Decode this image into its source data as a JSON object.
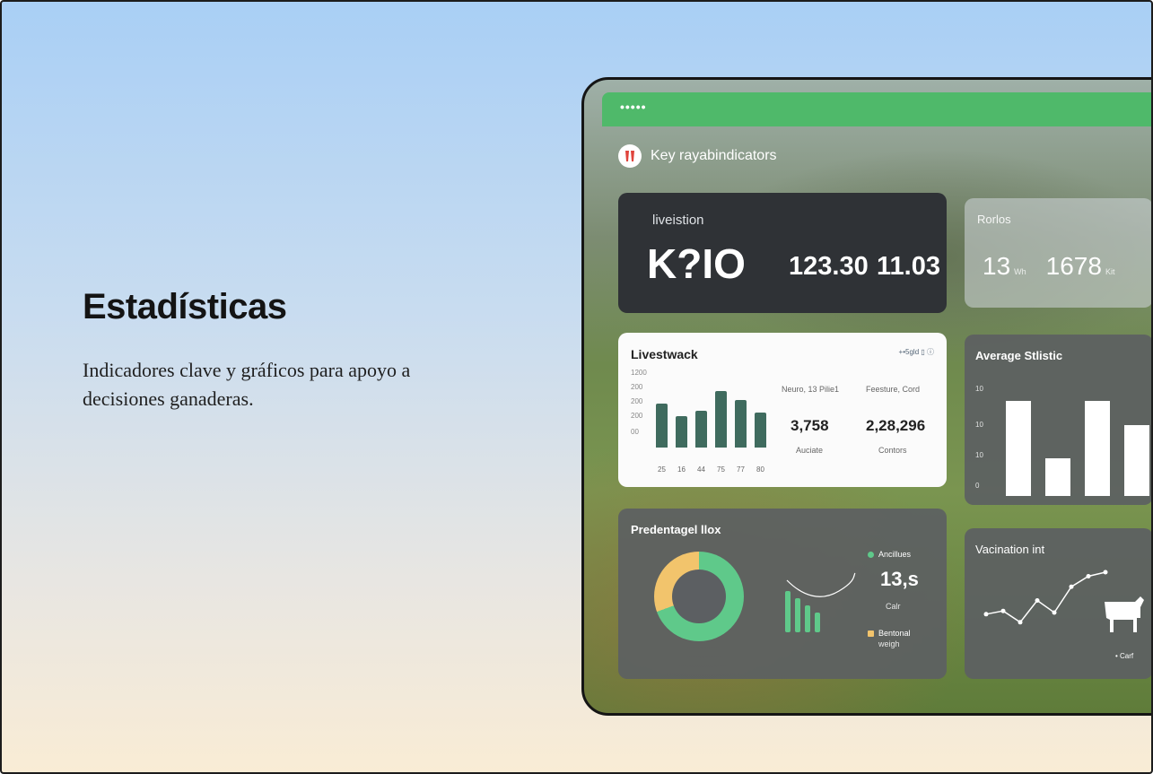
{
  "hero": {
    "title": "Estadísticas",
    "subtitle": "Indicadores clave y gráficos para apoyo a decisiones ganaderas."
  },
  "dashboard": {
    "window_dots": "•••••",
    "brand_title": "Key rayabindicators",
    "kpi_card": {
      "label": "liveistion",
      "main_value": "K?IO",
      "value_1": "123.30",
      "value_2": "11.03"
    },
    "ratio_card": {
      "label": "Rorlos",
      "value_1": "13",
      "unit_1": "Wh",
      "value_2": "1678",
      "unit_2": "Kit"
    },
    "livestock_card": {
      "title": "Livestwack",
      "legend": "+•5gld  ▯  ⓘ",
      "stat_1_label": "Neuro, 13 Pilie1",
      "stat_1_value": "3,758",
      "stat_1_caption": "Auciate",
      "stat_2_label": "Feesture, Cord",
      "stat_2_value": "2,28,296",
      "stat_2_caption": "Contors"
    },
    "average_card": {
      "title": "Average Stlistic",
      "y_ticks": [
        "10",
        "10",
        "10",
        "0"
      ]
    },
    "percentage_card": {
      "title": "Predentagel llox",
      "legend_1": "Ancillues",
      "big_value": "13,s",
      "caption": "Calr",
      "legend_2": "Bentonal",
      "legend_2b": "weigh"
    },
    "vaccination_card": {
      "title": "Vacination int",
      "legend": "• Carf"
    }
  },
  "chart_data": [
    {
      "type": "bar",
      "title": "Livestwack",
      "categories": [
        "25",
        "16",
        "44",
        "75",
        "77",
        "80"
      ],
      "y_ticks": [
        "1200",
        "200",
        "200",
        "200",
        "00"
      ],
      "values": [
        72,
        52,
        60,
        92,
        78,
        58
      ],
      "color": "#3f6b5e"
    },
    {
      "type": "bar",
      "title": "Average Stlistic",
      "values": [
        10,
        4,
        10,
        7.5
      ],
      "ylim": [
        0,
        10
      ],
      "color": "#ffffff"
    },
    {
      "type": "pie",
      "title": "Predentagel llox",
      "series": [
        {
          "name": "Ancillues",
          "value": 70
        },
        {
          "name": "Bentonal weigh",
          "value": 30
        }
      ],
      "colors": [
        "#5fc98a",
        "#f2c46c"
      ]
    },
    {
      "type": "line",
      "title": "Vacination int",
      "values": [
        38,
        42,
        28,
        55,
        40,
        72,
        85,
        90
      ],
      "color": "#ffffff"
    }
  ],
  "colors": {
    "accent": "#4fb96a",
    "dark_card": "#2f3236",
    "grey_card": "#5c5f62"
  }
}
